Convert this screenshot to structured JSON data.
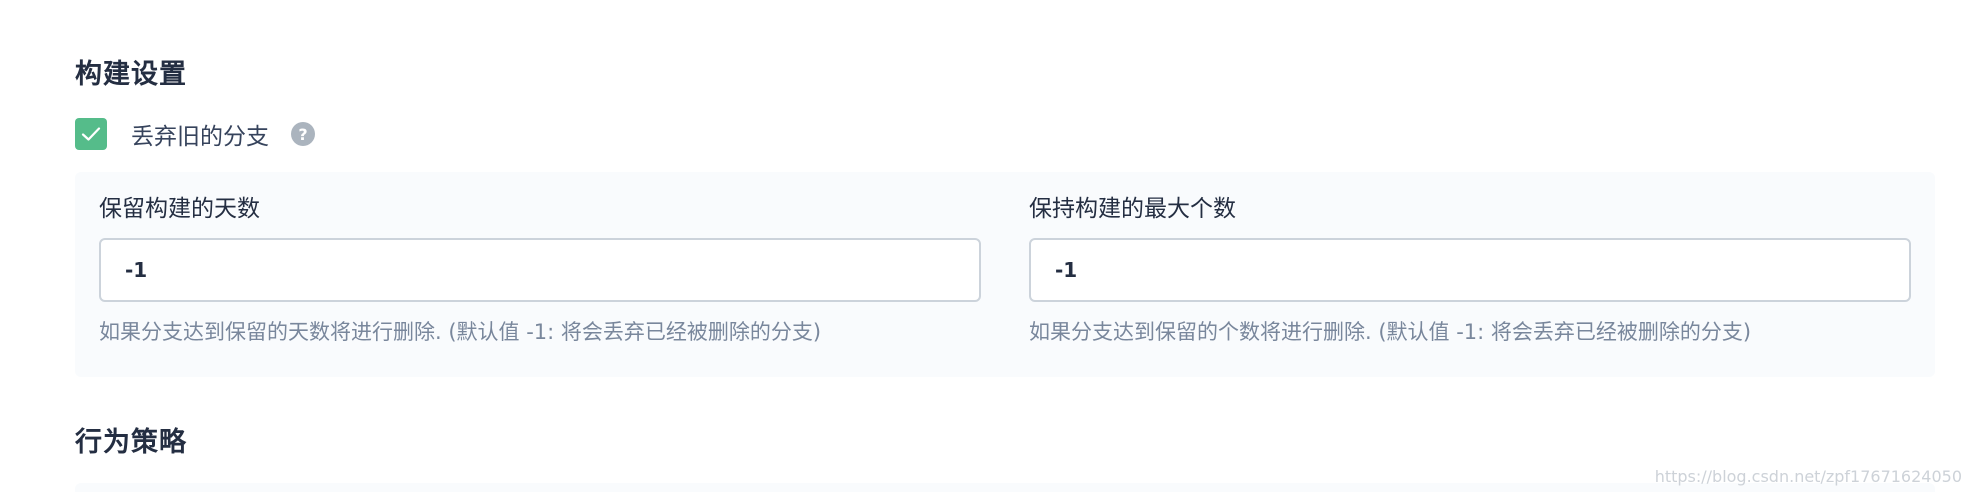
{
  "build_settings": {
    "title": "构建设置",
    "discard_old_branches": {
      "label": "丢弃旧的分支",
      "checked": true,
      "help_glyph": "?"
    },
    "days_to_keep": {
      "label": "保留构建的天数",
      "value": "-1",
      "description": "如果分支达到保留的天数将进行删除. (默认值 -1: 将会丢弃已经被删除的分支)"
    },
    "max_count": {
      "label": "保持构建的最大个数",
      "value": "-1",
      "description": "如果分支达到保留的个数将进行删除. (默认值 -1: 将会丢弃已经被删除的分支)"
    }
  },
  "behavior_strategy": {
    "title": "行为策略"
  },
  "watermark": "https://blog.csdn.net/zpf17671624050",
  "colors": {
    "checkbox_checked": "#55bc8a",
    "panel_bg": "#f9fbfd",
    "help_icon": "#abb4be",
    "description_text": "#79879c"
  }
}
